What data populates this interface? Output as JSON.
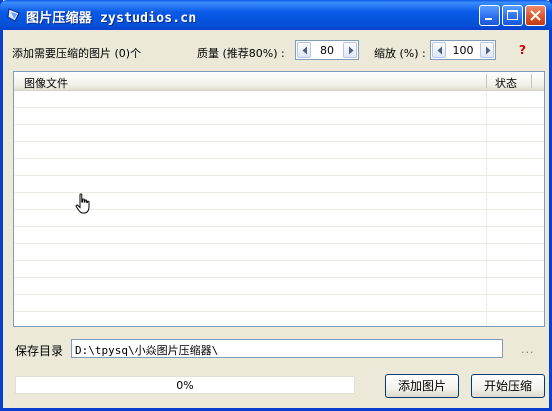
{
  "window": {
    "title": "图片压缩器 zystudios.cn"
  },
  "toolbar": {
    "image_count_label": "添加需要压缩的图片 (0)个",
    "quality_label": "质量 (推荐80%) :",
    "quality_value": "80",
    "scale_label": "缩放 (%) :",
    "scale_value": "100",
    "help_label": "?"
  },
  "file_list": {
    "columns": [
      "图像文件",
      "状态"
    ],
    "rows": []
  },
  "save": {
    "label": "保存目录",
    "path": "D:\\tpysq\\小焱图片压缩器\\",
    "browse_label": "..."
  },
  "progress": {
    "percent_text": "0%",
    "value": 0
  },
  "buttons": {
    "add_images": "添加图片",
    "start_compress": "开始压缩"
  },
  "colors": {
    "titlebar": "#0a5ae8",
    "progress_fill": "#2ec24a",
    "help": "#d40000"
  },
  "icons": [
    "app-icon",
    "minimize-icon",
    "maximize-icon",
    "close-icon",
    "spin-left-icon",
    "spin-right-icon",
    "hand-cursor-icon"
  ]
}
